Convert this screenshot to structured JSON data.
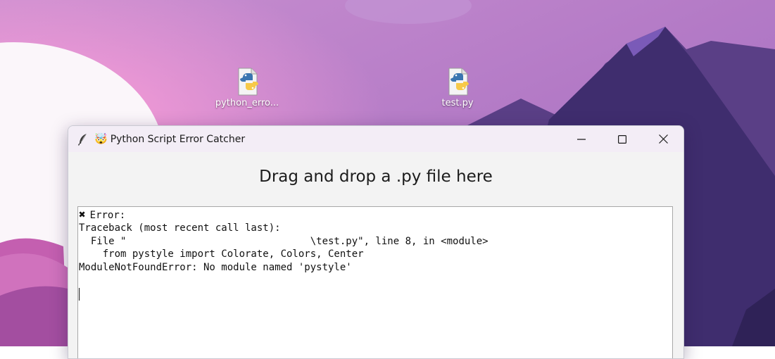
{
  "desktop": {
    "icons": [
      {
        "label": "python_erro..."
      },
      {
        "label": "test.py"
      }
    ]
  },
  "window": {
    "title_emoji": "🤯",
    "title": "Python Script Error Catcher",
    "controls": {
      "minimize": "minimize",
      "maximize": "maximize",
      "close": "close"
    },
    "heading": "Drag and drop a .py file here",
    "output": {
      "error_mark": "✖",
      "error_label": "Error:",
      "lines": [
        "Traceback (most recent call last):",
        "  File \"                               \\test.py\", line 8, in <module>",
        "    from pystyle import Colorate, Colors, Center",
        "ModuleNotFoundError: No module named 'pystyle'"
      ]
    }
  },
  "colors": {
    "wallpaper_top": "#b57fc6",
    "mountain": "#3f2d6e",
    "titlebar": "#f3edf6",
    "window_bg": "#f3f3f3"
  }
}
